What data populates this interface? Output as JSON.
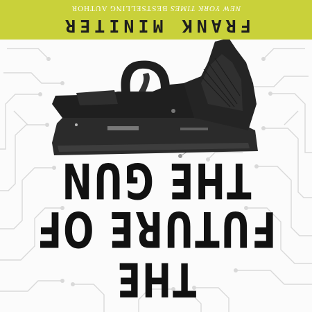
{
  "book": {
    "title_lines": [
      "THE",
      "FUTURE OF",
      "THE GUN"
    ],
    "author": "FRANK MINITER",
    "tagline_italic": "NEW YORK TIMES",
    "tagline_rest": " BESTSELLING AUTHOR"
  },
  "colors": {
    "band": "#c9d13a",
    "title": "#111111",
    "circuit": "#d6d6d6",
    "gun_body": "#2b2b2b"
  },
  "display": {
    "orientation": "upside-down"
  }
}
